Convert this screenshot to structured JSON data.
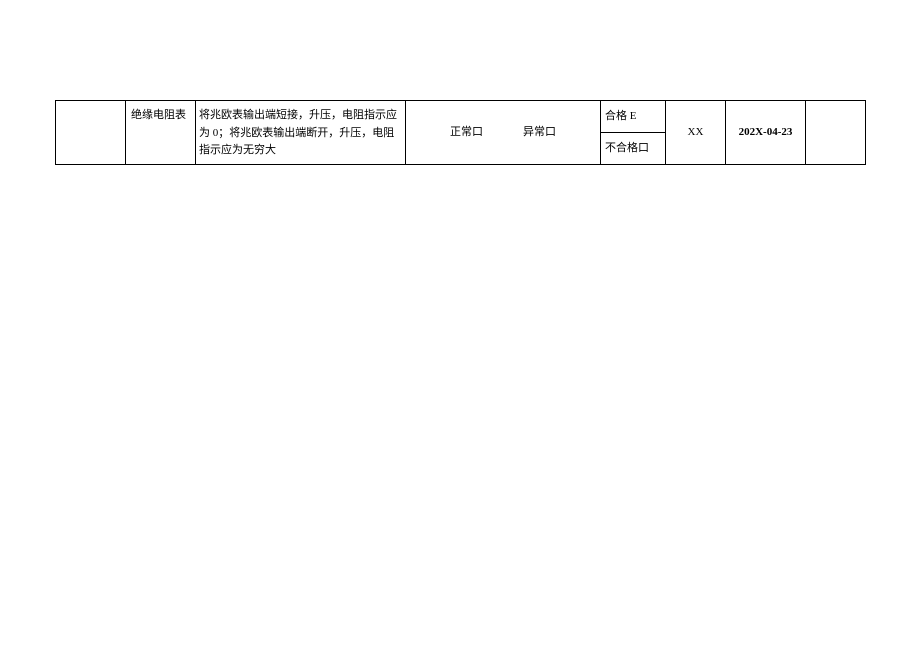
{
  "row": {
    "col1": "",
    "col2": "绝缘电阻表",
    "col3": "将兆欧表输出端短接，升压，电阻指示应为 0；将兆欧表输出端断开，升压，电阻指示应为无穷大",
    "status_normal": "正常口",
    "status_abnormal": "异常口",
    "result_pass": "合格 E",
    "result_fail": "不合格口",
    "col6": "XX",
    "col7": "202X-04-23",
    "col8": ""
  }
}
